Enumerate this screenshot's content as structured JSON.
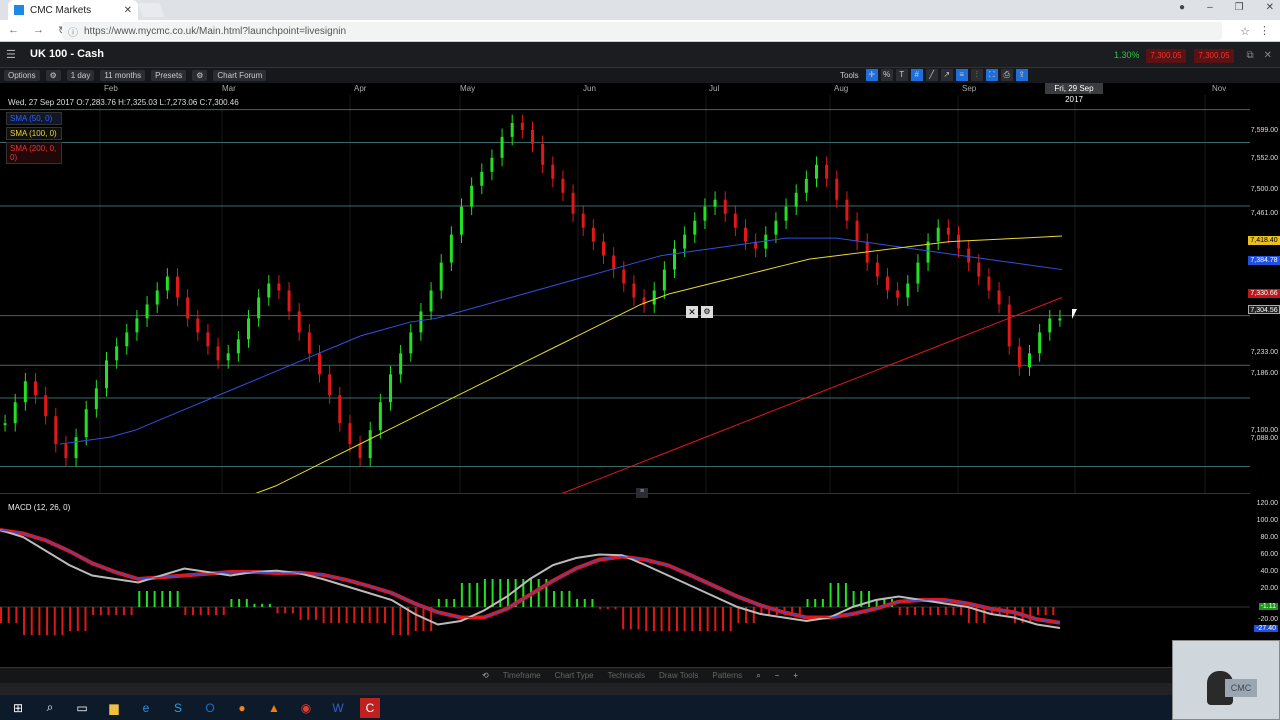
{
  "browser": {
    "tab_title": "CMC Markets",
    "url": "https://www.mycmc.co.uk/Main.html?launchpoint=livesignin"
  },
  "app": {
    "instrument": "UK 100 - Cash",
    "change_pct": "1.30%",
    "sell_price": "7,300.05",
    "buy_price": "7,300.05"
  },
  "toolbar": {
    "options": "Options",
    "interval": "1 day",
    "range": "11 months",
    "presets": "Presets",
    "chart_forum": "Chart Forum",
    "tools": "Tools"
  },
  "months": [
    "Feb",
    "Mar",
    "Apr",
    "May",
    "Jun",
    "Jul",
    "Aug",
    "Sep",
    "Nov"
  ],
  "crosshair_date": "Fri, 29 Sep 2017",
  "info_line": "Wed, 27 Sep 2017  O:7,283.76  H:7,325.03  L:7,273.06  C:7,300.46",
  "legend": {
    "sma1": "SMA (50, 0)",
    "sma2": "SMA (100, 0)",
    "sma3": "SMA (200, 0, 0)"
  },
  "price_levels": [
    "7,599.00",
    "7,552.00",
    "7,500.00",
    "7,461.00",
    "7,418.40",
    "7,384.78",
    "7,330.66",
    "7,304.56",
    "7,233.00",
    "7,186.00",
    "7,100.00",
    "7,088.00"
  ],
  "macd_label": "MACD (12, 26, 0)",
  "macd_levels": [
    "120.00",
    "100.00",
    "80.00",
    "60.00",
    "40.00",
    "20.00",
    "-1.11",
    "-20.00",
    "-27.40"
  ],
  "bottom": {
    "timeframe": "Timeframe",
    "chart_type": "Chart Type",
    "technicals": "Technicals",
    "draw_tools": "Draw Tools",
    "patterns": "Patterns"
  },
  "colors": {
    "bull": "#22e022",
    "bear": "#e01818",
    "sma50": "#3050e0",
    "sma100": "#e8d830",
    "sma200": "#e01818",
    "hline": "#3a6a6a"
  },
  "chart_data": {
    "type": "candlestick",
    "ylim": [
      7050,
      7620
    ],
    "h_lines": [
      7599,
      7552,
      7461,
      7304,
      7233,
      7186,
      7088
    ],
    "closes": [
      7150,
      7180,
      7210,
      7190,
      7160,
      7120,
      7100,
      7130,
      7170,
      7200,
      7240,
      7260,
      7280,
      7300,
      7320,
      7340,
      7360,
      7330,
      7300,
      7280,
      7260,
      7240,
      7250,
      7270,
      7300,
      7330,
      7350,
      7340,
      7310,
      7280,
      7250,
      7220,
      7190,
      7150,
      7120,
      7100,
      7140,
      7180,
      7220,
      7250,
      7280,
      7310,
      7340,
      7380,
      7420,
      7460,
      7490,
      7510,
      7530,
      7560,
      7580,
      7570,
      7550,
      7520,
      7500,
      7480,
      7450,
      7430,
      7410,
      7390,
      7370,
      7350,
      7330,
      7320,
      7340,
      7370,
      7400,
      7420,
      7440,
      7460,
      7470,
      7450,
      7430,
      7410,
      7400,
      7420,
      7440,
      7460,
      7480,
      7500,
      7520,
      7500,
      7470,
      7440,
      7410,
      7380,
      7360,
      7340,
      7330,
      7350,
      7380,
      7410,
      7430,
      7420,
      7400,
      7380,
      7360,
      7340,
      7320,
      7260,
      7230,
      7250,
      7280,
      7300,
      7300
    ],
    "sma50": [
      7120,
      7125,
      7130,
      7140,
      7155,
      7170,
      7185,
      7200,
      7215,
      7230,
      7245,
      7260,
      7275,
      7285,
      7295,
      7300,
      7310,
      7320,
      7330,
      7340,
      7350,
      7360,
      7370,
      7380,
      7390,
      7395,
      7400,
      7405,
      7410,
      7415,
      7415,
      7415,
      7410,
      7405,
      7400,
      7395,
      7390,
      7385,
      7380,
      7375,
      7370
    ],
    "sma100": [
      7000,
      7010,
      7020,
      7030,
      7045,
      7060,
      7080,
      7100,
      7120,
      7140,
      7160,
      7180,
      7200,
      7220,
      7240,
      7260,
      7280,
      7300,
      7320,
      7335,
      7345,
      7355,
      7365,
      7375,
      7385,
      7390,
      7395,
      7400,
      7405,
      7410,
      7412,
      7414,
      7416,
      7418
    ],
    "sma200": [
      6950,
      6970,
      6990,
      7010,
      7030,
      7050,
      7070,
      7090,
      7110,
      7130,
      7150,
      7170,
      7190,
      7210,
      7230,
      7250,
      7270,
      7290,
      7310,
      7330
    ],
    "macd": [
      110,
      100,
      80,
      60,
      45,
      40,
      35,
      45,
      55,
      50,
      45,
      50,
      52,
      48,
      40,
      30,
      20,
      10,
      -10,
      -25,
      -20,
      -5,
      15,
      40,
      60,
      70,
      75,
      74,
      60,
      45,
      30,
      15,
      0,
      -10,
      -15,
      -20,
      -15,
      0,
      10,
      15,
      10,
      5,
      0,
      -10,
      -15,
      -25,
      -30
    ]
  }
}
